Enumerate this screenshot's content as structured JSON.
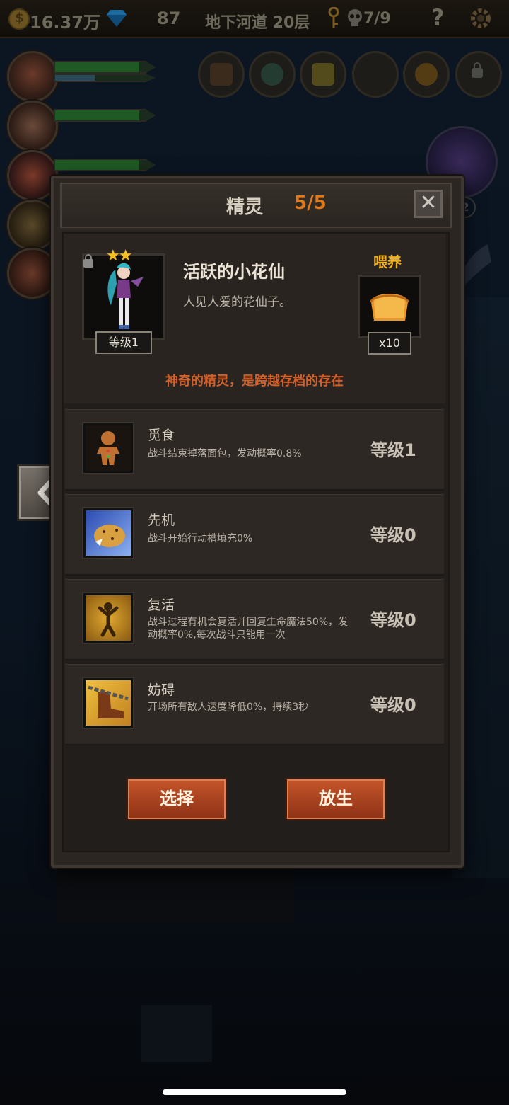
{
  "topbar": {
    "gold": "16.37万",
    "gems": "87",
    "location": "地下河道 20层",
    "keys": "7/9",
    "help": "?"
  },
  "background": {
    "angel_badge": "2"
  },
  "dialog": {
    "title": "精灵",
    "count": "5/5",
    "close": "✕",
    "fairy": {
      "stars": "★★",
      "level": "等级1",
      "name": "活跃的小花仙",
      "description": "人见人爱的花仙子。",
      "feed_label": "喂养",
      "feed_count": "x10"
    },
    "tagline": "神奇的精灵，是跨越存档的存在",
    "skills": [
      {
        "name": "觅食",
        "desc": "战斗结束掉落面包，发动概率0.8%",
        "level": "等级1",
        "icon": "gingerbread-icon"
      },
      {
        "name": "先机",
        "desc": "战斗开始行动槽填充0%",
        "level": "等级0",
        "icon": "leopard-icon"
      },
      {
        "name": "复活",
        "desc": "战斗过程有机会复活并回复生命魔法50%，发动概率0%,每次战斗只能用一次",
        "level": "等级0",
        "icon": "revive-icon"
      },
      {
        "name": "妨碍",
        "desc": "开场所有敌人速度降低0%，持续3秒",
        "level": "等级0",
        "icon": "chained-boot-icon"
      }
    ],
    "buttons": {
      "select": "选择",
      "release": "放生"
    }
  },
  "colors": {
    "accent_orange": "#e07a1a",
    "feed_gold": "#f0b020",
    "tagline_red": "#d2602a",
    "button_red": "#b0441f"
  }
}
